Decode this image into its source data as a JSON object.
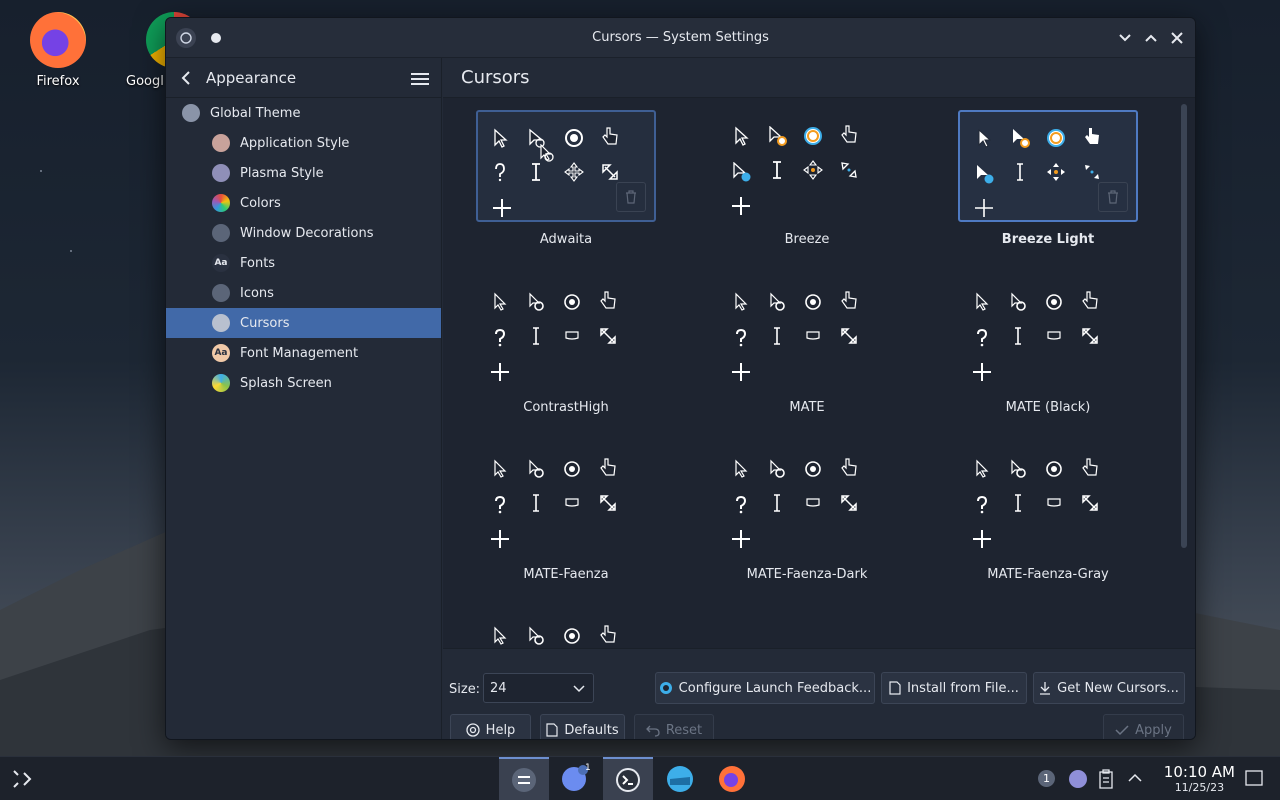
{
  "desktop": {
    "icons": [
      {
        "label": "Firefox"
      },
      {
        "label": "Googl"
      }
    ]
  },
  "window": {
    "title": "Cursors — System Settings"
  },
  "sidebar": {
    "back_label": "Appearance",
    "items": [
      {
        "label": "Global Theme",
        "icon": "global-theme-icon",
        "level": 0
      },
      {
        "label": "Application Style",
        "icon": "application-style-icon",
        "level": 1
      },
      {
        "label": "Plasma Style",
        "icon": "plasma-style-icon",
        "level": 1
      },
      {
        "label": "Colors",
        "icon": "colors-icon",
        "level": 1
      },
      {
        "label": "Window Decorations",
        "icon": "window-decorations-icon",
        "level": 1
      },
      {
        "label": "Fonts",
        "icon": "fonts-icon",
        "level": 1
      },
      {
        "label": "Icons",
        "icon": "icons-icon",
        "level": 1
      },
      {
        "label": "Cursors",
        "icon": "cursors-icon",
        "level": 1,
        "active": true
      },
      {
        "label": "Font Management",
        "icon": "font-management-icon",
        "level": 1
      },
      {
        "label": "Splash Screen",
        "icon": "splash-screen-icon",
        "level": 1
      }
    ]
  },
  "main": {
    "title": "Cursors",
    "themes": [
      {
        "name": "Adwaita",
        "selected": false,
        "hovered": true
      },
      {
        "name": "Breeze",
        "selected": false
      },
      {
        "name": "Breeze Light",
        "selected": true
      },
      {
        "name": "ContrastHigh"
      },
      {
        "name": "MATE"
      },
      {
        "name": "MATE (Black)"
      },
      {
        "name": "MATE-Faenza"
      },
      {
        "name": "MATE-Faenza-Dark"
      },
      {
        "name": "MATE-Faenza-Gray"
      },
      {
        "name": ""
      }
    ],
    "size_label": "Size:",
    "size_value": "24",
    "buttons": {
      "configure_launch_feedback": "Configure Launch Feedback...",
      "install_from_file": "Install from File...",
      "get_new_cursors": "Get New Cursors...",
      "help": "Help",
      "defaults": "Defaults",
      "reset": "Reset",
      "apply": "Apply"
    }
  },
  "taskbar": {
    "time": "10:10 AM",
    "date": "11/25/23",
    "notification_count": "1",
    "store_badge": "1"
  },
  "colors": {
    "accent": "#4169a8",
    "selection_border": "#4f7ac2",
    "window_bg": "#232a37"
  }
}
